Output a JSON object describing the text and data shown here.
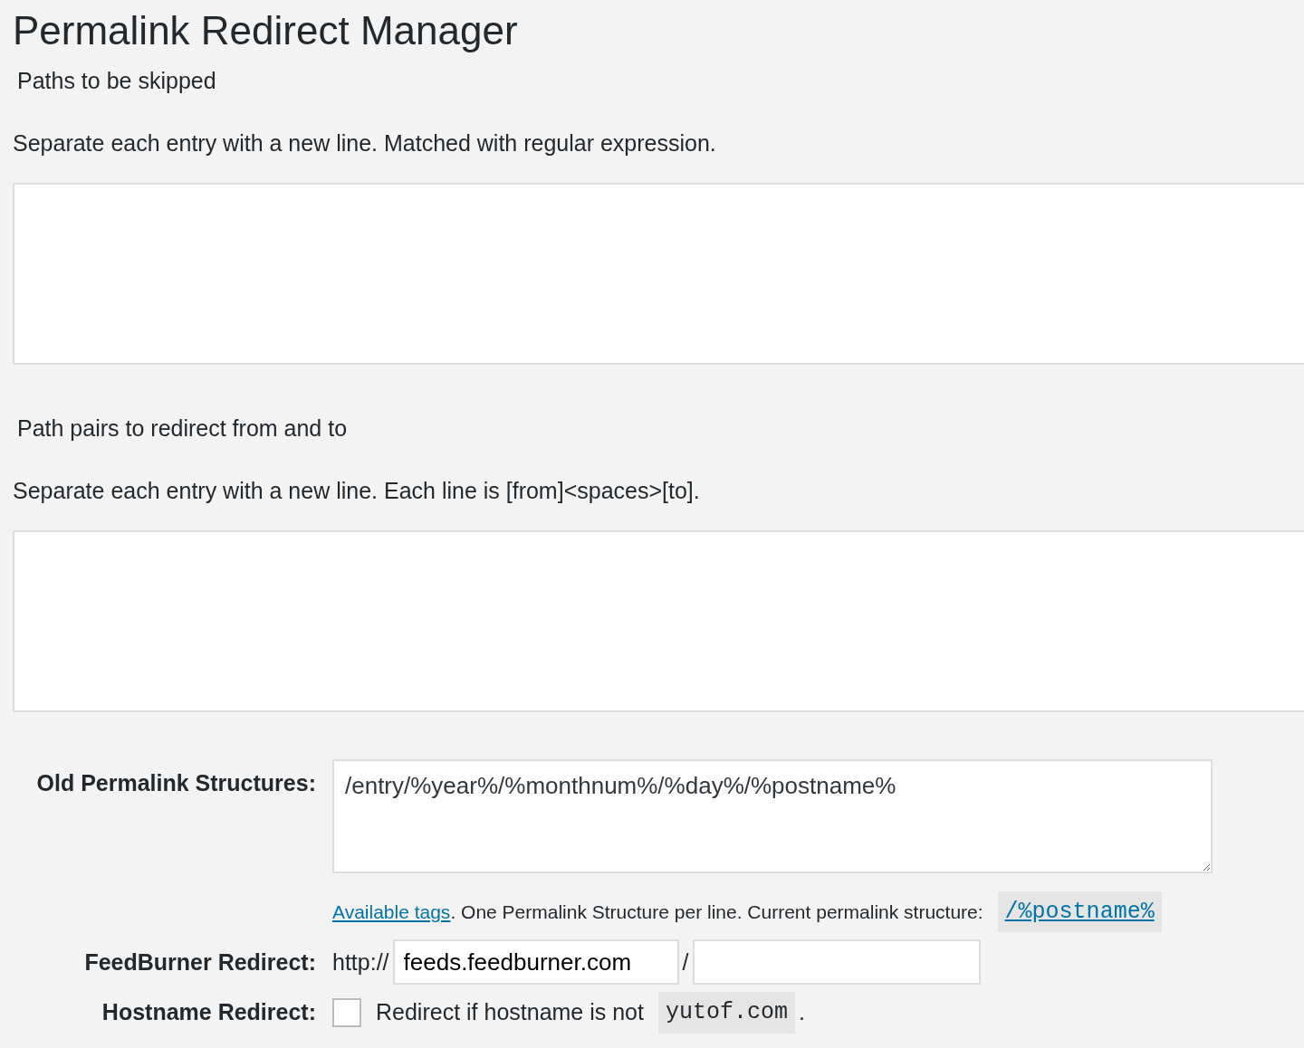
{
  "title": "Permalink Redirect Manager",
  "sections": [
    {
      "heading": "Paths to be skipped",
      "description": "Separate each entry with a new line. Matched with regular expression."
    },
    {
      "heading": "Path pairs to redirect from and to",
      "description": "Separate each entry with a new line. Each line is [from]<spaces>[to]."
    }
  ],
  "form": {
    "old_structures": {
      "label": "Old Permalink Structures:",
      "value": "/entry/%year%/%monthnum%/%day%/%postname%",
      "help_link": "Available tags",
      "help_text": ". One Permalink Structure per line. Current permalink structure:",
      "current_structure": "/%postname%"
    },
    "feedburner": {
      "label": "FeedBurner Redirect:",
      "prefix": "http://",
      "host_value": "feeds.feedburner.com",
      "separator": "/"
    },
    "hostname": {
      "label": "Hostname Redirect:",
      "checked": false,
      "text": "Redirect if hostname is not",
      "hostname": "yutof.com",
      "suffix": "."
    }
  }
}
